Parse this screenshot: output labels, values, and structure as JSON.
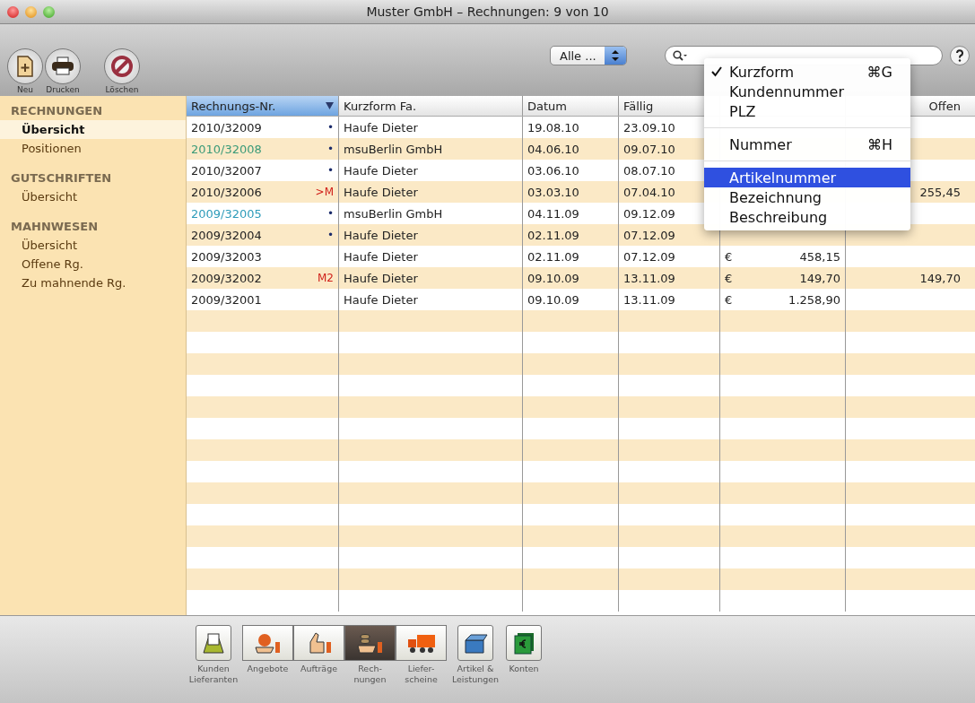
{
  "window": {
    "title": "Muster GmbH – Rechnungen: 9 von 10"
  },
  "toolbar": {
    "buttons": [
      {
        "kind": "new",
        "label": "Neu"
      },
      {
        "kind": "print",
        "label": "Drucken"
      },
      {
        "kind": "delete",
        "label": "Löschen"
      }
    ],
    "filter": {
      "value": "Alle ..."
    }
  },
  "sidebar": {
    "sections": [
      {
        "title": "RECHNUNGEN",
        "items": [
          {
            "label": "Übersicht",
            "selected": true
          },
          {
            "label": "Positionen",
            "selected": false
          }
        ]
      },
      {
        "title": "GUTSCHRIFTEN",
        "items": [
          {
            "label": "Übersicht",
            "selected": false
          }
        ]
      },
      {
        "title": "MAHNWESEN",
        "items": [
          {
            "label": "Übersicht",
            "selected": false
          },
          {
            "label": "Offene Rg.",
            "selected": false
          },
          {
            "label": "Zu mahnende Rg.",
            "selected": false
          }
        ]
      }
    ]
  },
  "table": {
    "columns": [
      {
        "label": "Rechnungs-Nr.",
        "sorted": true
      },
      {
        "label": "Kurzform Fa.",
        "sorted": false
      },
      {
        "label": "Datum",
        "sorted": false
      },
      {
        "label": "Fällig",
        "sorted": false
      },
      {
        "label": "Offen",
        "sorted": false
      }
    ],
    "rows": [
      {
        "number": "2010/32009",
        "color": "#222222",
        "mark": {
          "text": "•",
          "color": "#1a2a6a"
        },
        "company": "Haufe Dieter",
        "date": "19.08.10",
        "due": "23.09.10"
      },
      {
        "number": "2010/32008",
        "color": "#3a9a78",
        "mark": {
          "text": "•",
          "color": "#1a2a6a"
        },
        "company": "msuBerlin GmbH",
        "date": "04.06.10",
        "due": "09.07.10"
      },
      {
        "number": "2010/32007",
        "color": "#222222",
        "mark": {
          "text": "•",
          "color": "#1a2a6a"
        },
        "company": "Haufe Dieter",
        "date": "03.06.10",
        "due": "08.07.10"
      },
      {
        "number": "2010/32006",
        "color": "#222222",
        "mark": {
          "text": ">M",
          "color": "#d0201a"
        },
        "company": "Haufe Dieter",
        "date": "03.03.10",
        "due": "07.04.10",
        "open": "255,45"
      },
      {
        "number": "2009/32005",
        "color": "#2f9cba",
        "mark": {
          "text": "•",
          "color": "#1a2a6a"
        },
        "company": "msuBerlin GmbH",
        "date": "04.11.09",
        "due": "09.12.09"
      },
      {
        "number": "2009/32004",
        "color": "#222222",
        "mark": {
          "text": "•",
          "color": "#1a2a6a"
        },
        "company": "Haufe Dieter",
        "date": "02.11.09",
        "due": "07.12.09"
      },
      {
        "number": "2009/32003",
        "color": "#222222",
        "company": "Haufe Dieter",
        "date": "02.11.09",
        "due": "07.12.09",
        "currency": "€",
        "amount": "458,15"
      },
      {
        "number": "2009/32002",
        "color": "#222222",
        "mark": {
          "text": "M2",
          "color": "#d0201a"
        },
        "company": "Haufe Dieter",
        "date": "09.10.09",
        "due": "13.11.09",
        "currency": "€",
        "amount": "149,70",
        "open": "149,70"
      },
      {
        "number": "2009/32001",
        "color": "#222222",
        "company": "Haufe Dieter",
        "date": "09.10.09",
        "due": "13.11.09",
        "currency": "€",
        "amount": "1.258,90"
      }
    ]
  },
  "menu": {
    "groups": [
      [
        {
          "label": "Kurzform",
          "shortcut": "⌘G",
          "checked": true,
          "selected": false
        },
        {
          "label": "Kundennummer",
          "checked": false,
          "selected": false
        },
        {
          "label": "PLZ",
          "checked": false,
          "selected": false
        }
      ],
      [
        {
          "label": "Nummer",
          "shortcut": "⌘H",
          "checked": false,
          "selected": false
        }
      ],
      [
        {
          "label": "Artikelnummer",
          "checked": false,
          "selected": true
        },
        {
          "label": "Bezeichnung",
          "checked": false,
          "selected": false
        },
        {
          "label": "Beschreibung",
          "checked": false,
          "selected": false
        }
      ]
    ]
  },
  "module_groups": [
    [
      {
        "kind": "contacts",
        "label": "Kunden\nLieferanten",
        "selected": false
      }
    ],
    [
      {
        "kind": "offer",
        "label": "Angebote",
        "selected": false
      },
      {
        "kind": "order",
        "label": "Aufträge",
        "selected": false
      },
      {
        "kind": "invoice",
        "label": "Rech-\nnungen",
        "selected": true
      },
      {
        "kind": "delivery",
        "label": "Liefer-\nscheine",
        "selected": false
      }
    ],
    [
      {
        "kind": "articles",
        "label": "Artikel &\nLeistungen",
        "selected": false
      }
    ],
    [
      {
        "kind": "accounts",
        "label": "Konten",
        "selected": false
      }
    ]
  ]
}
